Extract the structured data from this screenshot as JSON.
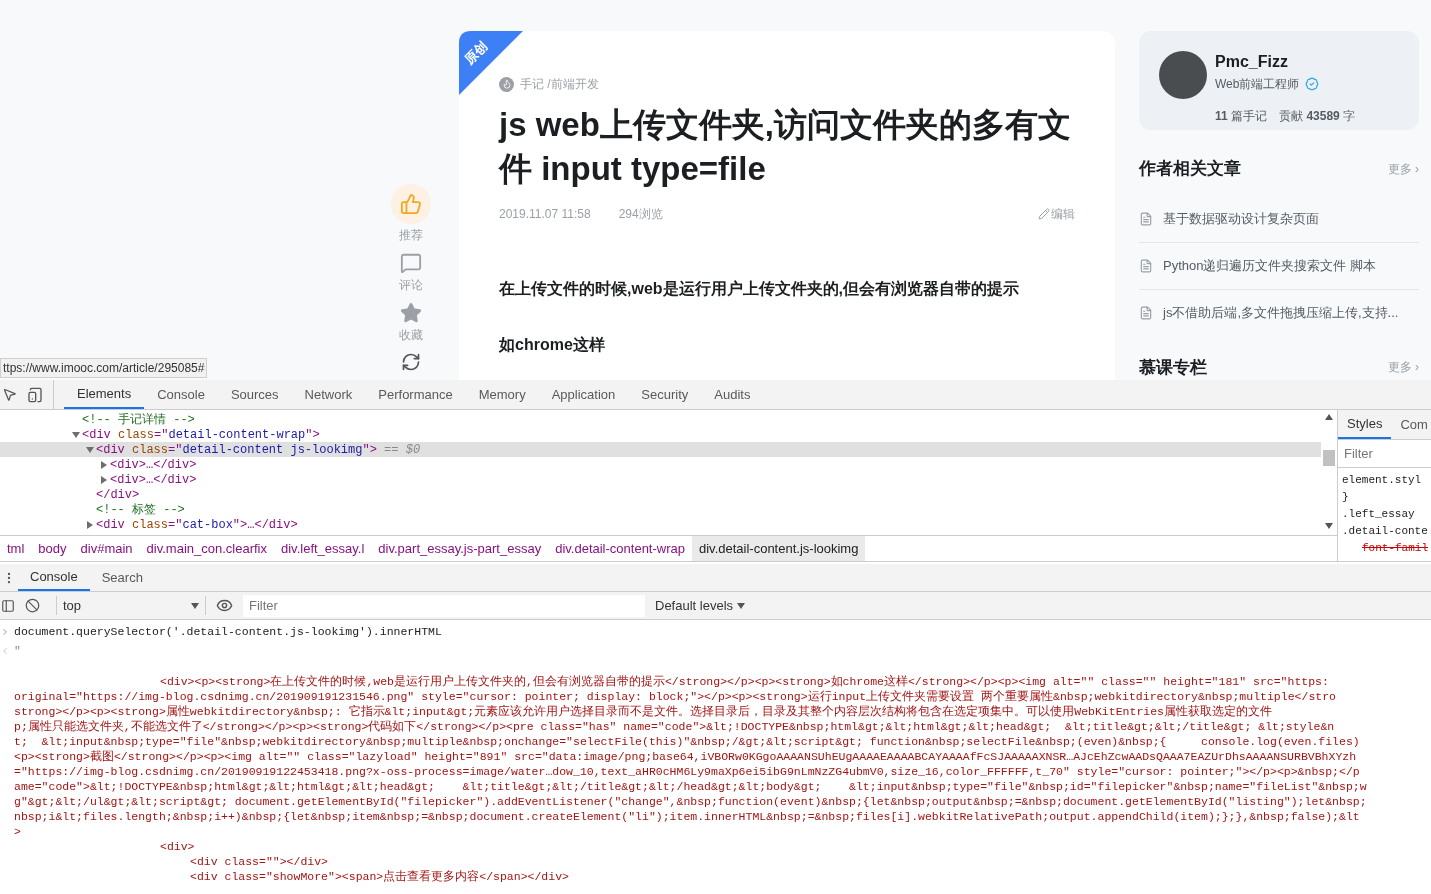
{
  "page": {
    "actions": [
      {
        "kind": "like",
        "label": "推荐"
      },
      {
        "kind": "comment",
        "label": "评论"
      },
      {
        "kind": "collect",
        "label": "收藏"
      },
      {
        "kind": "share"
      }
    ],
    "article": {
      "badge": "原创",
      "category": "手记 /前端开发",
      "title": "js web上传文件夹,访问文件夹的多有文件 input type=file",
      "date": "2019.11.07 11:58",
      "views": "294浏览",
      "edit": "编辑",
      "paragraphs": [
        "在上传文件的时候,web是运行用户上传文件夹的,但会有浏览器自带的提示",
        "如chrome这样"
      ]
    },
    "author": {
      "name": "Pmc_Fizz",
      "role": "Web前端工程师",
      "stats": [
        "**11** 篇手记",
        "贡献 **43589** 字"
      ]
    },
    "sections": [
      {
        "title": "作者相关文章",
        "more": "更多 ›",
        "items": [
          "基于数据驱动设计复杂页面",
          "Python递归遍历文件夹搜索文件 脚本",
          "js不借助后端,多文件拖拽压缩上传,支持..."
        ]
      },
      {
        "title": "慕课专栏",
        "more": "更多 ›"
      }
    ],
    "status_url": "ttps://www.imooc.com/article/295085#"
  },
  "devtools": {
    "tabs": [
      {
        "label": "Elements",
        "selected": true
      },
      {
        "label": "Console",
        "selected": false
      },
      {
        "label": "Sources",
        "selected": false
      },
      {
        "label": "Network",
        "selected": false
      },
      {
        "label": "Performance",
        "selected": false
      },
      {
        "label": "Memory",
        "selected": false
      },
      {
        "label": "Application",
        "selected": false
      },
      {
        "label": "Security",
        "selected": false
      },
      {
        "label": "Audits",
        "selected": false
      }
    ],
    "dom": [
      {
        "parts": [
          {
            "kind": "comment",
            "t": "<!-- 手记详情 -->"
          }
        ],
        "selected": false
      },
      {
        "parts": [
          {
            "kind": "tag",
            "t": "<div "
          },
          {
            "kind": "attr",
            "t": "class"
          },
          {
            "kind": "tag",
            "t": "=\""
          },
          {
            "kind": "value",
            "t": "detail-content-wrap"
          },
          {
            "kind": "tag",
            "t": "\">"
          }
        ],
        "expanded": true,
        "selected": false,
        "children": [
          {
            "parts": [
              {
                "kind": "tag",
                "t": "<div "
              },
              {
                "kind": "attr",
                "t": "class"
              },
              {
                "kind": "tag",
                "t": "=\""
              },
              {
                "kind": "value",
                "t": "detail-content js-lookimg"
              },
              {
                "kind": "tag",
                "t": "\">"
              },
              {
                "kind": "note",
                "t": " == $0"
              }
            ],
            "expanded": true,
            "selected": true,
            "close": "</div>",
            "children": [
              {
                "parts": [
                  {
                    "kind": "tag",
                    "t": "<div>…</div>"
                  }
                ],
                "expanded": false,
                "selected": false
              },
              {
                "parts": [
                  {
                    "kind": "tag",
                    "t": "<div>…</div>"
                  }
                ],
                "expanded": false,
                "selected": false
              }
            ]
          },
          {
            "parts": [
              {
                "kind": "comment",
                "t": "<!-- 标签 -->"
              }
            ],
            "selected": false
          },
          {
            "parts": [
              {
                "kind": "tag",
                "t": "<div "
              },
              {
                "kind": "attr",
                "t": "class"
              },
              {
                "kind": "tag",
                "t": "=\""
              },
              {
                "kind": "value",
                "t": "cat-box"
              },
              {
                "kind": "tag",
                "t": "\">…</div>"
              }
            ],
            "expanded": false,
            "selected": false
          }
        ]
      }
    ],
    "styles": {
      "tabs": [
        {
          "label": "Styles",
          "selected": true
        },
        {
          "label": "Com",
          "selected": false
        }
      ],
      "filter_placeholder": "Filter",
      "rules": [
        {
          "kind": "selector",
          "text": "element.styl"
        },
        {
          "kind": "brace",
          "text": "}"
        },
        {
          "kind": "selector",
          "text": ".left_essay"
        },
        {
          "kind": "selector",
          "text": ".detail-conte"
        },
        {
          "kind": "overridden",
          "text": "font-famil"
        }
      ]
    },
    "breadcrumbs": [
      {
        "label": "tml",
        "selected": false
      },
      {
        "label": "body",
        "selected": false
      },
      {
        "label": "div#main",
        "selected": false
      },
      {
        "label": "div.main_con.clearfix",
        "selected": false
      },
      {
        "label": "div.left_essay.l",
        "selected": false
      },
      {
        "label": "div.part_essay.js-part_essay",
        "selected": false
      },
      {
        "label": "div.detail-content-wrap",
        "selected": false
      },
      {
        "label": "div.detail-content.js-lookimg",
        "selected": true
      }
    ],
    "drawer_tabs": [
      {
        "label": "Console",
        "selected": true
      },
      {
        "label": "Search",
        "selected": false
      }
    ],
    "console_toolbar": {
      "context": "top",
      "filter_placeholder": "Filter",
      "levels": "Default levels"
    },
    "console": [
      {
        "kind": "input",
        "text": "document.querySelector('.detail-content.js-lookimg').innerHTML"
      },
      {
        "kind": "result",
        "text": "\""
      },
      {
        "kind": "indent1",
        "text": "<div><p><strong>在上传文件的时候,web是运行用户上传文件夹的,但会有浏览器自带的提示</strong></p><p><strong>如chrome这样</strong></p><p><img alt=\"\" class=\"\" height=\"181\" src=\"https:"
      },
      {
        "kind": "output",
        "text": "original=\"https://img-blog.csdnimg.cn/201909191231546.png\" style=\"cursor: pointer; display: block;\"></p><p><strong>运行input上传文件夹需要设置 两个重要属性&nbsp;webkitdirectory&nbsp;multiple</stro"
      },
      {
        "kind": "output",
        "text": "strong></p><p><strong>属性webkitdirectory&nbsp;: 它指示&lt;input&gt;元素应该允许用户选择目录而不是文件。选择目录后，目录及其整个内容层次结构将包含在选定项集中。可以使用WebKitEntries属性获取选定的文件"
      },
      {
        "kind": "output",
        "text": "p;属性只能选文件夹,不能选文件了</strong></p><p><strong>代码如下</strong></p><pre class=\"has\" name=\"code\">&lt;!DOCTYPE&nbsp;html&gt;&lt;html&gt;&lt;head&gt;  &lt;title&gt;&lt;/title&gt; &lt;style&n"
      },
      {
        "kind": "output",
        "text": "t;  &lt;input&nbsp;type=\"file\"&nbsp;webkitdirectory&nbsp;multiple&nbsp;onchange=\"selectFile(this)\"&nbsp;/&gt;&lt;script&gt; function&nbsp;selectFile&nbsp;(even)&nbsp;{     console.log(even.files)"
      },
      {
        "kind": "output",
        "text": "<p><strong>截图</strong></p><p><img alt=\"\" class=\"lazyload\" height=\"891\" src=\"data:image/png;base64,iVBORw0KGgoAAAANSUhEUgAAAAEAAAABCAYAAAAfFcSJAAAAAXNSR…AJcEhZcwAADsQAAA7EAZUrDhsAAAANSURBVBhXYzh"
      },
      {
        "kind": "output",
        "text": "=\"https://img-blog.csdnimg.cn/20190919122453418.png?x-oss-process=image/water…dow_10,text_aHR0cHM6Ly9maXp6ei5ibG9nLmNzZG4ubmV0,size_16,color_FFFFFF,t_70\" style=\"cursor: pointer;\"></p><p>&nbsp;</p"
      },
      {
        "kind": "output",
        "text": "ame=\"code\">&lt;!DOCTYPE&nbsp;html&gt;&lt;html&gt;&lt;head&gt;    &lt;title&gt;&lt;/title&gt;&lt;/head&gt;&lt;body&gt;    &lt;input&nbsp;type=\"file\"&nbsp;id=\"filepicker\"&nbsp;name=\"fileList\"&nbsp;w"
      },
      {
        "kind": "output",
        "text": "g\"&gt;&lt;/ul&gt;&lt;script&gt; document.getElementById(\"filepicker\").addEventListener(\"change\",&nbsp;function(event)&nbsp;{let&nbsp;output&nbsp;=&nbsp;document.getElementById(\"listing\");let&nbsp;"
      },
      {
        "kind": "output",
        "text": "nbsp;i&lt;files.length;&nbsp;i++)&nbsp;{let&nbsp;item&nbsp;=&nbsp;document.createElement(\"li\");item.innerHTML&nbsp;=&nbsp;files[i].webkitRelativePath;output.appendChild(item);};},&nbsp;false);&lt"
      },
      {
        "kind": "output",
        "text": ">"
      },
      {
        "kind": "indent1",
        "text": "<div>"
      },
      {
        "kind": "indent2",
        "text": "<div class=\"\"></div>"
      },
      {
        "kind": "indent2",
        "text": "<div class=\"showMore\"><span>点击查看更多内容</span></div>"
      }
    ]
  }
}
